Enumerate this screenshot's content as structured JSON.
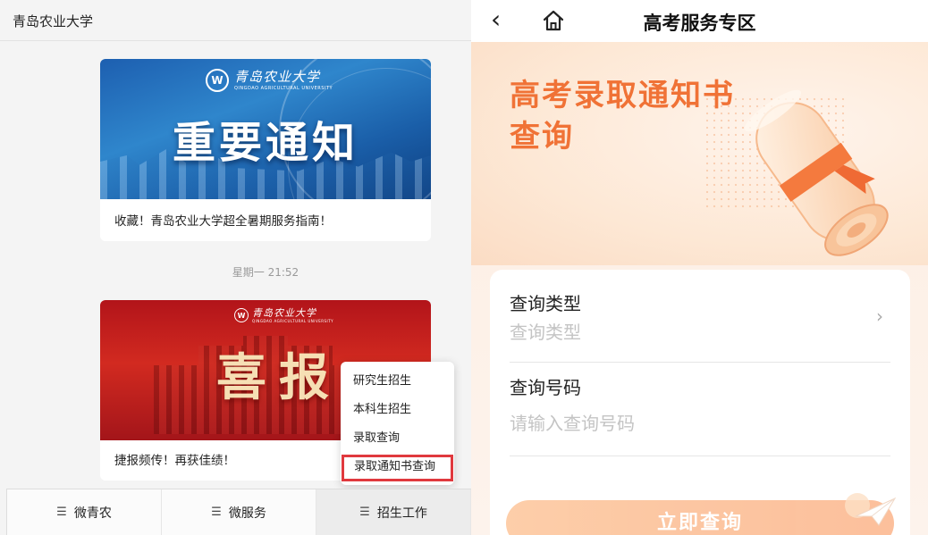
{
  "left": {
    "title": "青岛农业大学",
    "card1": {
      "logo_cn": "青岛农业大学",
      "logo_en": "QINGDAO AGRICULTURAL UNIVERSITY",
      "banner_text": "重要通知",
      "caption": "收藏！青岛农业大学超全暑期服务指南！"
    },
    "timestamp": "星期一 21:52",
    "card2": {
      "logo_cn": "青岛农业大学",
      "logo_en": "QINGDAO AGRICULTURAL UNIVERSITY",
      "banner_text": "喜报",
      "caption": "捷报频传！再获佳绩！"
    },
    "popup": {
      "items": [
        "研究生招生",
        "本科生招生",
        "录取查询",
        "录取通知书查询"
      ]
    },
    "menu": {
      "items": [
        {
          "label": "微青农",
          "icon": "menu-icon"
        },
        {
          "label": "微服务",
          "icon": "menu-icon"
        },
        {
          "label": "招生工作",
          "icon": "menu-icon"
        }
      ]
    }
  },
  "right": {
    "title": "高考服务专区",
    "hero": {
      "title_line1": "高考录取通知书",
      "title_line2": "查询"
    },
    "form": {
      "type_label": "查询类型",
      "type_placeholder": "查询类型",
      "number_label": "查询号码",
      "number_placeholder": "请输入查询号码",
      "submit_label": "立即查询"
    }
  },
  "colors": {
    "accent_orange": "#f07236",
    "highlight_red": "#e0393e",
    "button_orange": "#fbb48a"
  }
}
